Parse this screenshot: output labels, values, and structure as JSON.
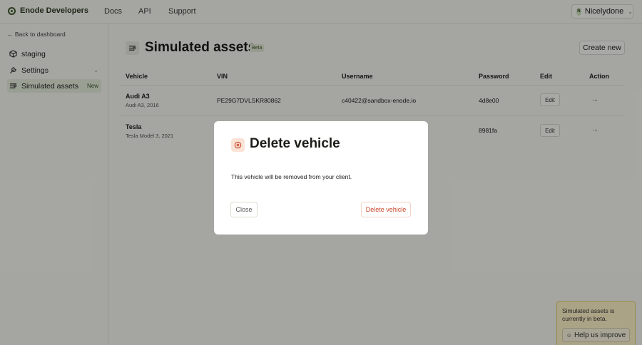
{
  "header": {
    "brand": "Enode Developers",
    "nav": [
      "Docs",
      "API",
      "Support"
    ],
    "user": {
      "initial": "N",
      "name": "Nicelydone"
    }
  },
  "sidebar": {
    "back_link": "← Back to dashboard",
    "items": [
      {
        "label": "staging",
        "icon": "cube-icon"
      },
      {
        "label": "Settings",
        "icon": "wrench-icon"
      },
      {
        "label": "Simulated assets",
        "icon": "sliders-icon",
        "tag": "New"
      }
    ]
  },
  "main": {
    "title": "Simulated assets",
    "badge": "Beta",
    "create_button": "Create new",
    "table": {
      "headers": [
        "Vehicle",
        "VIN",
        "Username",
        "Password",
        "Edit",
        "Action"
      ],
      "rows": [
        {
          "vehicle": "Audi A3",
          "vehicle_sub": "Audi A3, 2016",
          "vin": "PE29G7DVLSKR80862",
          "username": "c40422@sandbox-enode.io",
          "password": "4d8e00",
          "edit": "Edit",
          "action": "···"
        },
        {
          "vehicle": "Tesla",
          "vehicle_sub": "Tesla Model 3, 2021",
          "vin": "",
          "username": "",
          "password": "8981fa",
          "edit": "Edit",
          "action": "···"
        }
      ]
    }
  },
  "modal": {
    "title": "Delete vehicle",
    "message": "This vehicle will be removed from your client.",
    "close_label": "Close",
    "delete_label": "Delete vehicle",
    "icon": "x-circle-icon"
  },
  "toast": {
    "message": "Simulated assets is currently in beta.",
    "button": "Help us improve"
  },
  "colors": {
    "accent": "#3f5a2c",
    "danger": "#c6462a",
    "toast_bg": "#fff4c8"
  }
}
